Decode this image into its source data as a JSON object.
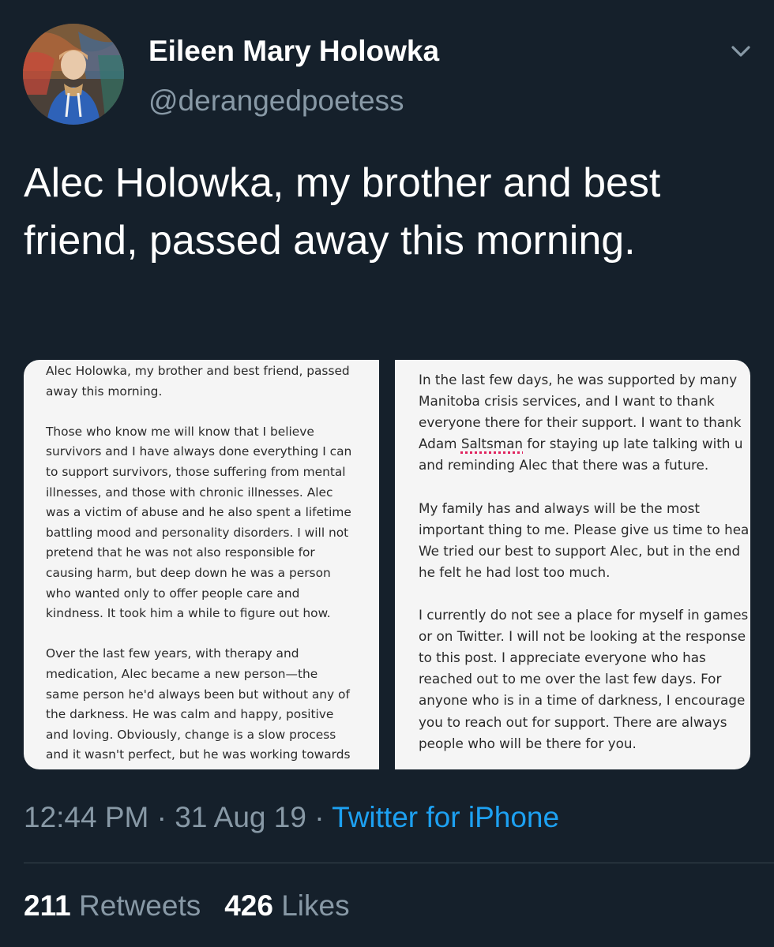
{
  "tweet": {
    "author": {
      "display_name": "Eileen Mary Holowka",
      "handle": "@derangedpoetess",
      "avatar_icon": "profile-photo"
    },
    "menu_icon": "chevron-down-icon",
    "text": "Alec Holowka, my brother and best friend, passed away this morning.",
    "media": [
      {
        "type": "image",
        "text": "Alec Holowka, my brother and best friend, passed\naway this morning.\n\nThose who know me will know that I believe\nsurvivors and I have always done everything I can\nto support survivors, those suffering from mental\nillnesses, and those with chronic illnesses. Alec\nwas a victim of abuse and he also spent a lifetime\nbattling mood and personality disorders. I will not\npretend that he was not also responsible for\ncausing harm, but deep down he was a person\nwho wanted only to offer people care and\nkindness. It took him a while to figure out how.\n\nOver the last few years, with therapy and\nmedication, Alec became a new person—the\nsame person he'd always been but without any of\nthe darkness. He was calm and happy, positive\nand loving. Obviously, change is a slow process\nand it wasn't perfect, but he was working towards\nrehabilitation and a better life."
      },
      {
        "type": "image",
        "text_before_underline": "In the last few days, he was supported by many\nManitoba crisis services, and I want to thank\neveryone there for their support. I want to thank\nAdam ",
        "underlined_word": "Saltsman",
        "text_after_underline": " for staying up late talking with u\nand reminding Alec that there was a future.\n\nMy family has and always will be the most\nimportant thing to me. Please give us time to hea\nWe tried our best to support Alec, but in the end\nhe felt he had lost too much.\n\nI currently do not see a place for myself in games\nor on Twitter. I will not be looking at the response\nto this post. I appreciate everyone who has\nreached out to me over the last few days. For\nanyone who is in a time of darkness, I encourage\nyou to reach out for support. There are always\npeople who will be there for you.",
        "spellcheck_color": "#e0245e"
      }
    ],
    "meta": {
      "time": "12:44 PM",
      "separator": " · ",
      "date": "31 Aug 19",
      "source": "Twitter for iPhone"
    },
    "stats": {
      "retweets_count": "211",
      "retweets_label": "Retweets",
      "likes_count": "426",
      "likes_label": "Likes"
    },
    "colors": {
      "background": "#15202b",
      "primary_text": "#ffffff",
      "secondary_text": "#8899a6",
      "link": "#1da1f2",
      "divider": "#38444d"
    }
  }
}
